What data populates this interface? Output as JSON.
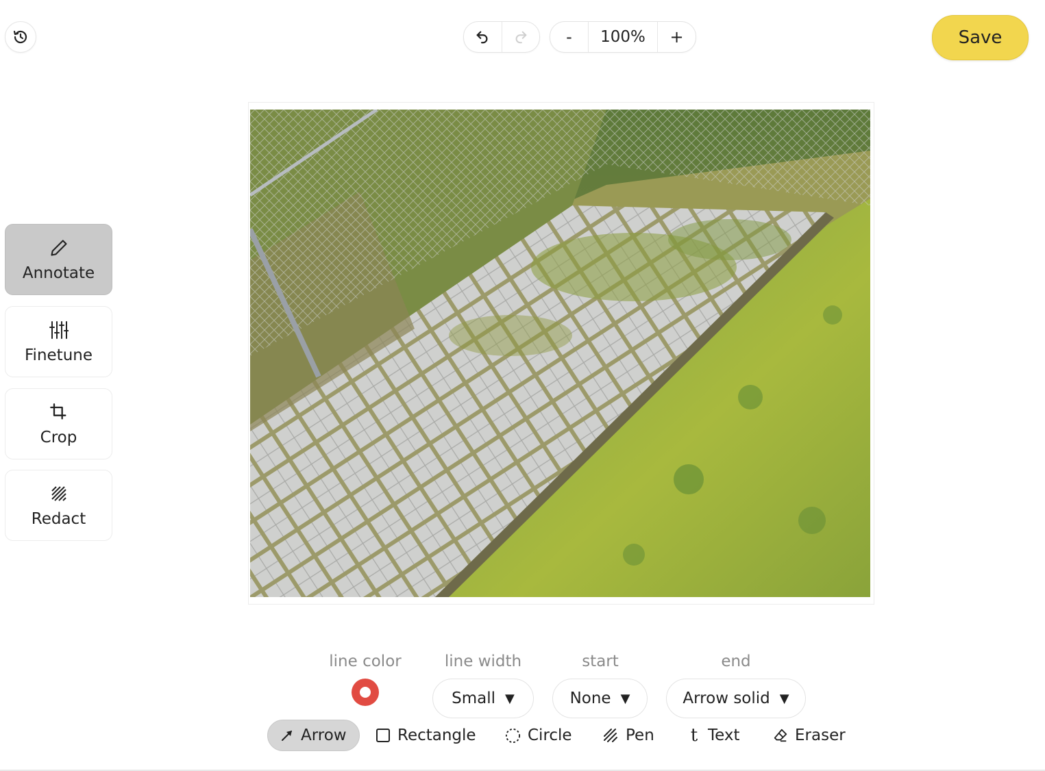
{
  "toolbar": {
    "history_icon": "history-icon",
    "undo_icon": "undo-icon",
    "redo_icon": "redo-icon",
    "zoom_out": "-",
    "zoom_value": "100%",
    "zoom_in": "+",
    "save_label": "Save",
    "save_color": "#f2d64e"
  },
  "sidebar": {
    "items": [
      {
        "label": "Annotate",
        "icon": "pencil-icon",
        "active": true
      },
      {
        "label": "Finetune",
        "icon": "sliders-icon",
        "active": false
      },
      {
        "label": "Crop",
        "icon": "crop-icon",
        "active": false
      },
      {
        "label": "Redact",
        "icon": "redact-icon",
        "active": false
      }
    ]
  },
  "annotate": {
    "line_color_label": "line color",
    "line_color": "#e14b42",
    "line_width_label": "line width",
    "line_width_value": "Small",
    "start_label": "start",
    "start_value": "None",
    "end_label": "end",
    "end_value": "Arrow solid",
    "caret": "▼",
    "tools": [
      {
        "label": "Arrow",
        "icon": "arrow-icon",
        "active": true
      },
      {
        "label": "Rectangle",
        "icon": "rectangle-icon",
        "active": false
      },
      {
        "label": "Circle",
        "icon": "circle-icon",
        "active": false
      },
      {
        "label": "Pen",
        "icon": "pen-icon",
        "active": false
      },
      {
        "label": "Text",
        "icon": "text-icon",
        "active": false
      },
      {
        "label": "Eraser",
        "icon": "eraser-icon",
        "active": false
      }
    ]
  }
}
